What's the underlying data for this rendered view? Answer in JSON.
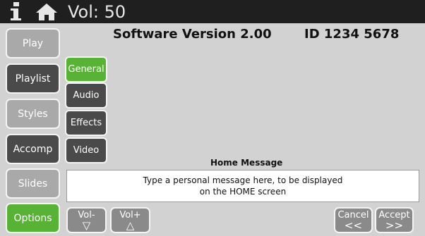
{
  "topbar": {
    "info_icon": "info-icon",
    "home_icon": "home-icon",
    "volume_text": "Vol: 50"
  },
  "sidebar": {
    "items": [
      {
        "label": "Play",
        "state": "light"
      },
      {
        "label": "Playlist",
        "state": "dark"
      },
      {
        "label": "Styles",
        "state": "light"
      },
      {
        "label": "Accomp",
        "state": "dark"
      },
      {
        "label": "Slides",
        "state": "light"
      },
      {
        "label": "Options",
        "state": "selected"
      }
    ]
  },
  "subtabs": {
    "items": [
      {
        "label": "General",
        "state": "selected"
      },
      {
        "label": "Audio",
        "state": "dark"
      },
      {
        "label": "Effects",
        "state": "dark"
      },
      {
        "label": "Video",
        "state": "dark"
      }
    ]
  },
  "header": {
    "version": "Software Version 2.00",
    "id": "ID 1234 5678"
  },
  "home_message": {
    "title": "Home Message",
    "line1": "Type a personal message here, to be displayed",
    "line2": "on the HOME screen"
  },
  "buttons": {
    "vol_down": {
      "label": "Vol-",
      "symbol": "▽"
    },
    "vol_up": {
      "label": "Vol+",
      "symbol": "△"
    },
    "cancel": {
      "label": "Cancel",
      "symbol": "<<"
    },
    "accept": {
      "label": "Accept",
      "symbol": ">>"
    }
  },
  "colors": {
    "selected": "#58b236",
    "dark_tab": "#4a4a4a",
    "light_tab": "#a9a9a9",
    "topbar": "#1f1f1f",
    "background": "#d2d2d2"
  }
}
